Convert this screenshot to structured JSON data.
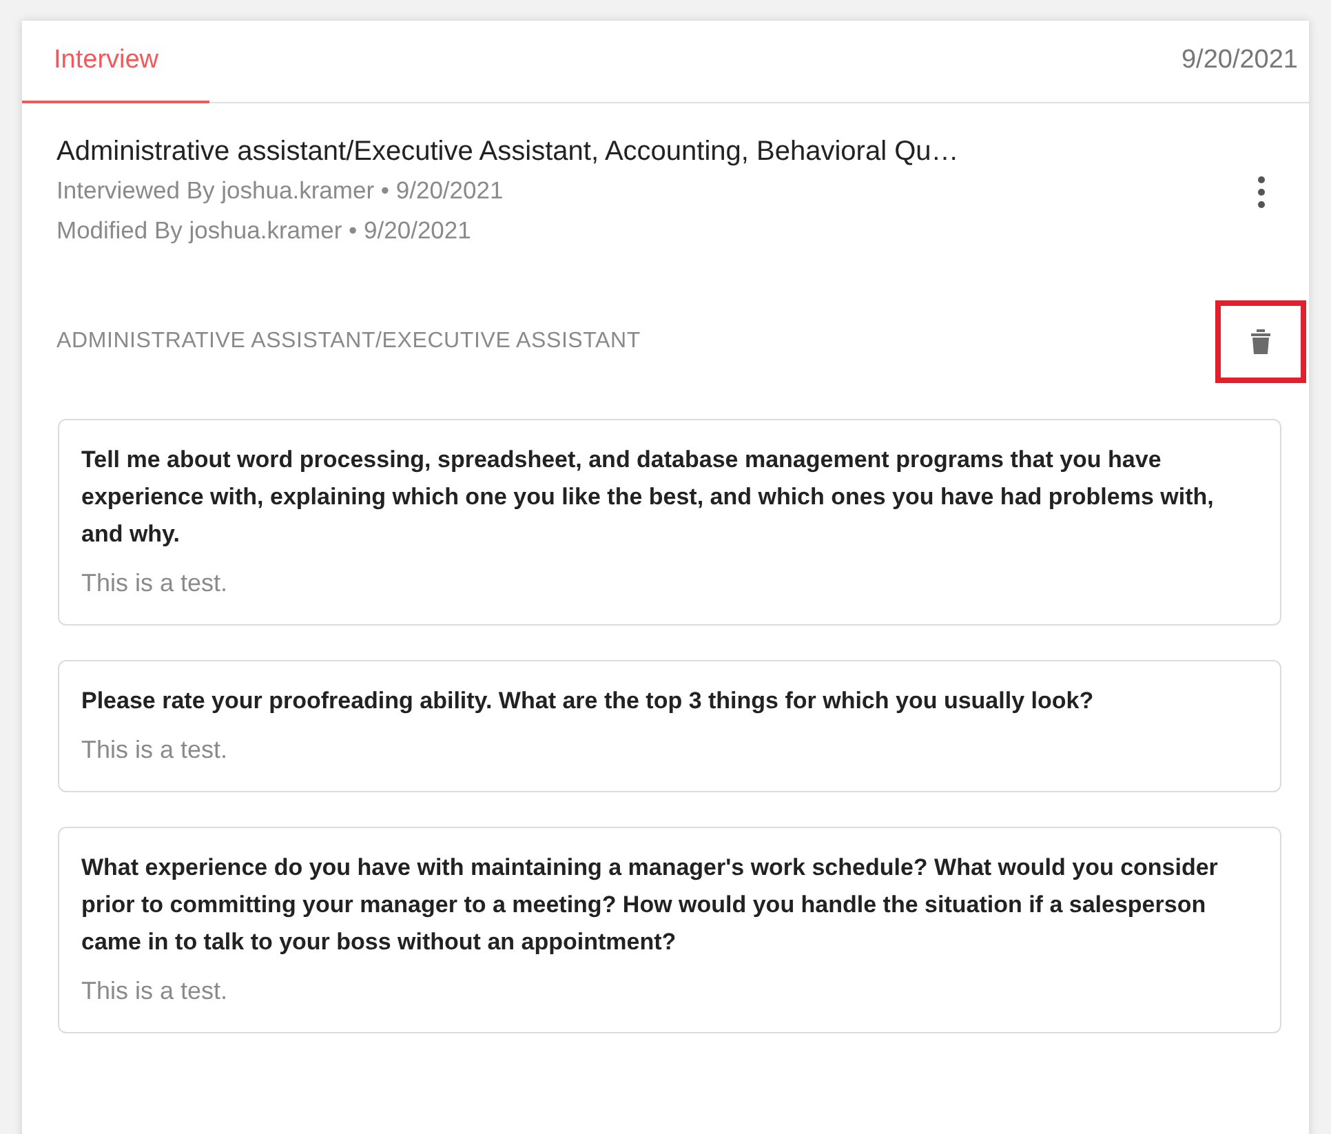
{
  "tabs": [
    {
      "label": "Interview",
      "selected": true
    }
  ],
  "header_date": "9/20/2021",
  "interview": {
    "title": "Administrative assistant/Executive Assistant, Accounting, Behavioral Qu…",
    "interviewed_by": "Interviewed By joshua.kramer • 9/20/2021",
    "modified_by": "Modified By joshua.kramer • 9/20/2021"
  },
  "section": {
    "title": "ADMINISTRATIVE ASSISTANT/EXECUTIVE ASSISTANT",
    "delete_highlighted": true
  },
  "questions": [
    {
      "question": "Tell me about word processing, spreadsheet, and database management programs that you have experience with, explaining which one you like the best, and which ones you have had problems with, and why.",
      "answer": "This is a test."
    },
    {
      "question": "Please rate your proofreading ability. What are the top 3 things for which you usually look?",
      "answer": "This is a test."
    },
    {
      "question": "What experience do you have with maintaining a manager's work schedule? What would you consider prior to committing your manager to a meeting? How would you handle the situation if a salesperson came in to talk to your boss without an appointment?",
      "answer": "This is a test."
    }
  ]
}
